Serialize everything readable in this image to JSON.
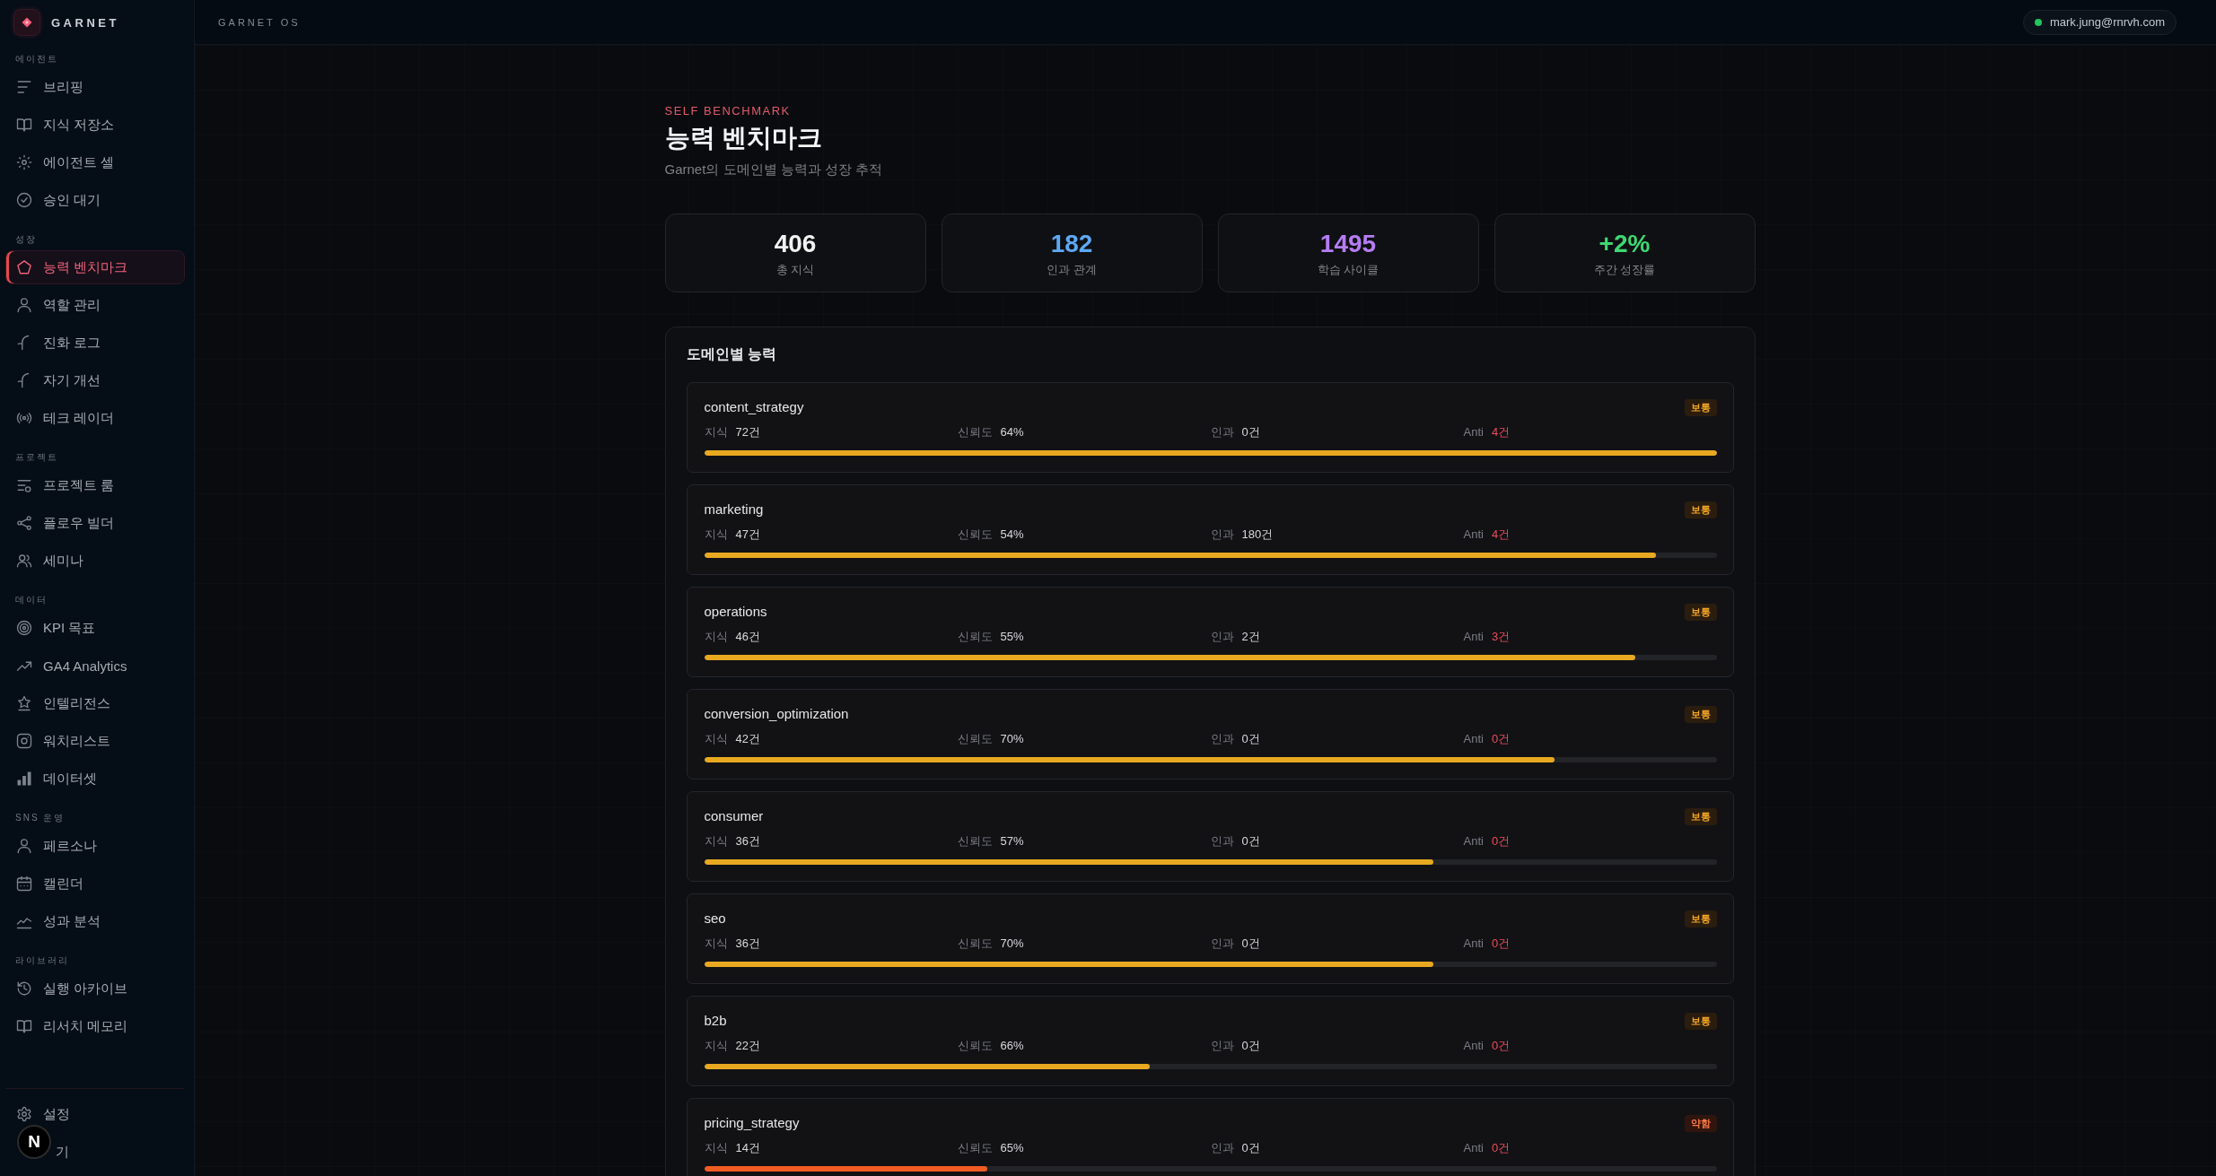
{
  "sidebar": {
    "brand": "GARNET",
    "sections": [
      {
        "title": "에이전트",
        "items": [
          {
            "label": "브리핑",
            "selected": false
          },
          {
            "label": "지식 저장소",
            "selected": false
          },
          {
            "label": "에이전트 셀",
            "selected": false
          },
          {
            "label": "승인 대기",
            "selected": false
          }
        ]
      },
      {
        "title": "성장",
        "items": [
          {
            "label": "능력 벤치마크",
            "selected": true
          },
          {
            "label": "역할 관리",
            "selected": false
          },
          {
            "label": "진화 로그",
            "selected": false
          },
          {
            "label": "자기 개선",
            "selected": false
          },
          {
            "label": "테크 레이더",
            "selected": false
          }
        ]
      },
      {
        "title": "프로젝트",
        "items": [
          {
            "label": "프로젝트 룸",
            "selected": false
          },
          {
            "label": "플로우 빌더",
            "selected": false
          },
          {
            "label": "세미나",
            "selected": false
          }
        ]
      },
      {
        "title": "데이터",
        "items": [
          {
            "label": "KPI 목표",
            "selected": false
          },
          {
            "label": "GA4 Analytics",
            "selected": false
          },
          {
            "label": "인텔리전스",
            "selected": false
          },
          {
            "label": "워치리스트",
            "selected": false
          },
          {
            "label": "데이터셋",
            "selected": false
          }
        ]
      },
      {
        "title": "SNS 운영",
        "items": [
          {
            "label": "페르소나",
            "selected": false
          },
          {
            "label": "캘린더",
            "selected": false
          },
          {
            "label": "성과 분석",
            "selected": false
          }
        ]
      },
      {
        "title": "라이브러리",
        "items": [
          {
            "label": "실행 아카이브",
            "selected": false
          },
          {
            "label": "리서치 메모리",
            "selected": false
          }
        ]
      }
    ],
    "footer_items": [
      {
        "label": "설정",
        "selected": false
      },
      {
        "label": "기",
        "selected": false
      }
    ]
  },
  "dev_badge": {
    "label": "N"
  },
  "topbar": {
    "title": "GARNET OS",
    "user": {
      "email": "mark.jung@rnrvh.com",
      "online": true
    }
  },
  "header": {
    "eyebrow": "SELF BENCHMARK",
    "title": "능력 벤치마크",
    "subtitle": "Garnet의 도메인별 능력과 성장 추적"
  },
  "stats": [
    {
      "value": "406",
      "label": "총 지식",
      "color": "#f2f2f2"
    },
    {
      "value": "182",
      "label": "인과 관계",
      "color": "#5ea8f5"
    },
    {
      "value": "1495",
      "label": "학습 사이클",
      "color": "#b67cf4"
    },
    {
      "value": "+2%",
      "label": "주간 성장률",
      "color": "#3ed873"
    }
  ],
  "domain_panel": {
    "title": "도메인별 능력",
    "domains": [
      {
        "name": "content_strategy",
        "badge": "보통",
        "kind": "normal",
        "level": 1.0,
        "metrics": [
          {
            "label": "지식",
            "value": "72건"
          },
          {
            "label": "신뢰도",
            "value": "64%"
          },
          {
            "label": "인과",
            "value": "0건"
          },
          {
            "label": "Anti",
            "value": "4건"
          }
        ]
      },
      {
        "name": "marketing",
        "badge": "보통",
        "kind": "normal",
        "level": 0.94,
        "metrics": [
          {
            "label": "지식",
            "value": "47건"
          },
          {
            "label": "신뢰도",
            "value": "54%"
          },
          {
            "label": "인과",
            "value": "180건"
          },
          {
            "label": "Anti",
            "value": "4건"
          }
        ]
      },
      {
        "name": "operations",
        "badge": "보통",
        "kind": "normal",
        "level": 0.92,
        "metrics": [
          {
            "label": "지식",
            "value": "46건"
          },
          {
            "label": "신뢰도",
            "value": "55%"
          },
          {
            "label": "인과",
            "value": "2건"
          },
          {
            "label": "Anti",
            "value": "3건"
          }
        ]
      },
      {
        "name": "conversion_optimization",
        "badge": "보통",
        "kind": "normal",
        "level": 0.84,
        "metrics": [
          {
            "label": "지식",
            "value": "42건"
          },
          {
            "label": "신뢰도",
            "value": "70%"
          },
          {
            "label": "인과",
            "value": "0건"
          },
          {
            "label": "Anti",
            "value": "0건"
          }
        ]
      },
      {
        "name": "consumer",
        "badge": "보통",
        "kind": "normal",
        "level": 0.72,
        "metrics": [
          {
            "label": "지식",
            "value": "36건"
          },
          {
            "label": "신뢰도",
            "value": "57%"
          },
          {
            "label": "인과",
            "value": "0건"
          },
          {
            "label": "Anti",
            "value": "0건"
          }
        ]
      },
      {
        "name": "seo",
        "badge": "보통",
        "kind": "normal",
        "level": 0.72,
        "metrics": [
          {
            "label": "지식",
            "value": "36건"
          },
          {
            "label": "신뢰도",
            "value": "70%"
          },
          {
            "label": "인과",
            "value": "0건"
          },
          {
            "label": "Anti",
            "value": "0건"
          }
        ]
      },
      {
        "name": "b2b",
        "badge": "보통",
        "kind": "normal",
        "level": 0.44,
        "metrics": [
          {
            "label": "지식",
            "value": "22건"
          },
          {
            "label": "신뢰도",
            "value": "66%"
          },
          {
            "label": "인과",
            "value": "0건"
          },
          {
            "label": "Anti",
            "value": "0건"
          }
        ]
      },
      {
        "name": "pricing_strategy",
        "badge": "약함",
        "kind": "weak",
        "level": 0.28,
        "metrics": [
          {
            "label": "지식",
            "value": "14건"
          },
          {
            "label": "신뢰도",
            "value": "65%"
          },
          {
            "label": "인과",
            "value": "0건"
          },
          {
            "label": "Anti",
            "value": "0건"
          }
        ]
      }
    ]
  }
}
